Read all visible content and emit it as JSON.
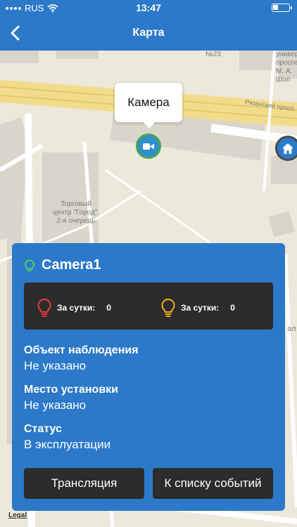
{
  "status_bar": {
    "carrier": "RUS",
    "time": "13:47"
  },
  "nav": {
    "title": "Карта"
  },
  "map": {
    "callout": "Камера",
    "mall_label_line1": "Торговый",
    "mall_label_line2": "центр \"Город\",",
    "mall_label_line3": "2-я очередь",
    "street_label": "Рязанский просп.",
    "univ_label_line1": "универс",
    "univ_label_line2": "проспе",
    "univ_label_line3": "М. А. Шол",
    "house_label": "№23",
    "side_label": "ал",
    "legal": "Legal"
  },
  "card": {
    "camera_name": "Camera1",
    "stats": [
      {
        "label": "За сутки:",
        "value": "0",
        "color": "#e43b3b"
      },
      {
        "label": "За сутки:",
        "value": "0",
        "color": "#f2ad1c"
      }
    ],
    "fields": [
      {
        "label": "Объект наблюдения",
        "value": "Не указано"
      },
      {
        "label": "Место установки",
        "value": "Не указано"
      },
      {
        "label": "Статус",
        "value": "В эксплуатации"
      }
    ],
    "stream_button": "Трансляция",
    "events_button": "К списку событий"
  },
  "colors": {
    "primary": "#2c79c9",
    "dark_panel": "#2c2c2c",
    "marker_ring": "#4aa34a"
  }
}
